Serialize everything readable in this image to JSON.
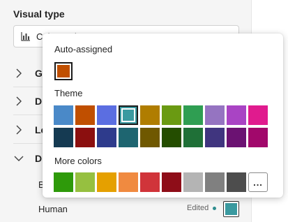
{
  "pane": {
    "visual_type_label": "Visual type",
    "visual_type_value": "Column chart",
    "sections": [
      {
        "label": "General",
        "short": "G",
        "expanded": false,
        "icon": "chevron-right-icon"
      },
      {
        "label": "Data labels",
        "short": "D",
        "expanded": false,
        "icon": "chevron-right-icon"
      },
      {
        "label": "Legend",
        "short": "Le",
        "expanded": false,
        "icon": "chevron-right-icon"
      },
      {
        "label": "Data colors",
        "short": "D",
        "expanded": true,
        "icon": "chevron-down-icon"
      }
    ],
    "series": [
      {
        "label": "B"
      },
      {
        "label": "Human",
        "status": "Edited",
        "color": "#3a9aa0"
      }
    ]
  },
  "color_picker": {
    "auto_heading": "Auto-assigned",
    "auto_color": "#c04f00",
    "theme_heading": "Theme",
    "theme_row1": [
      "#4a89c8",
      "#c04f00",
      "#5b6ee1",
      "#3a9aa0",
      "#b07d00",
      "#6a9a12",
      "#2f9e52",
      "#9574c1",
      "#a944c4",
      "#e01b8e"
    ],
    "theme_row2": [
      "#153a52",
      "#8b0f0f",
      "#2e3b8c",
      "#1e6570",
      "#6f5800",
      "#244d00",
      "#1f7037",
      "#40357f",
      "#6b1272",
      "#a1086b"
    ],
    "selected_index": 3,
    "more_heading": "More colors",
    "more_colors": [
      "#2e9a0a",
      "#96c040",
      "#e5a000",
      "#f08a40",
      "#d0343a",
      "#8e0d18",
      "#b4b4b4",
      "#808080",
      "#4d4d4d"
    ],
    "more_button_label": "..."
  }
}
